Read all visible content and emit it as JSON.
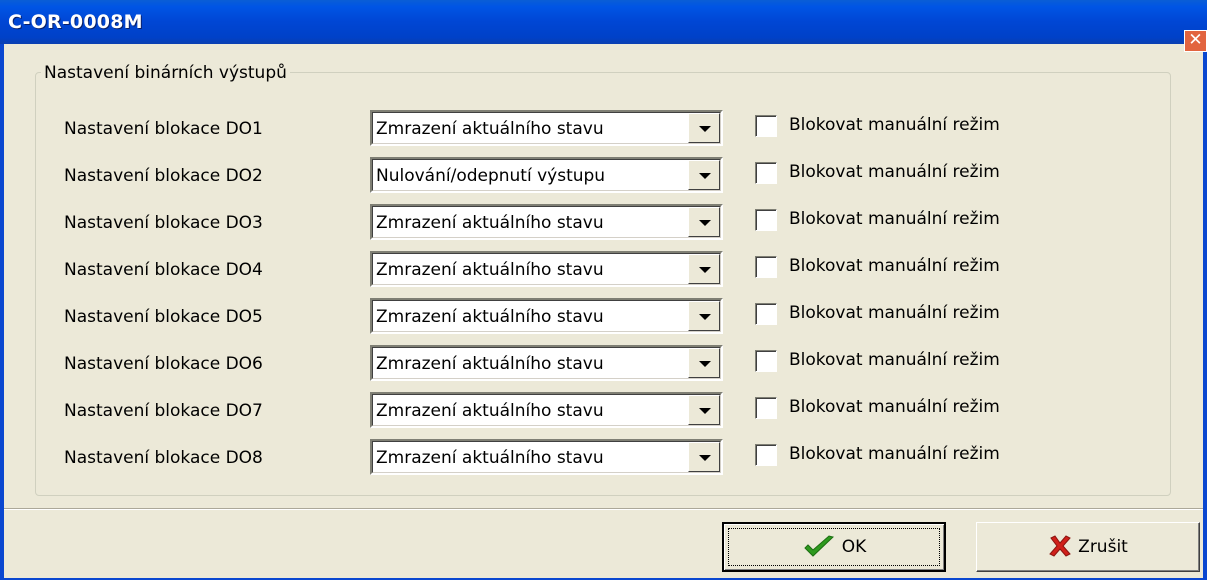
{
  "window": {
    "title": "C-OR-0008M",
    "close_icon": "close-icon"
  },
  "group": {
    "title": "Nastavení binárních výstupů"
  },
  "rows": [
    {
      "label": "Nastavení blokace DO1",
      "value": "Zmrazení aktuálního stavu",
      "checkbox_label": "Blokovat manuální režim",
      "checked": false
    },
    {
      "label": "Nastavení blokace DO2",
      "value": "Nulování/odepnutí výstupu",
      "checkbox_label": "Blokovat manuální režim",
      "checked": false
    },
    {
      "label": "Nastavení blokace DO3",
      "value": "Zmrazení aktuálního stavu",
      "checkbox_label": "Blokovat manuální režim",
      "checked": false
    },
    {
      "label": "Nastavení blokace DO4",
      "value": "Zmrazení aktuálního stavu",
      "checkbox_label": "Blokovat manuální režim",
      "checked": false
    },
    {
      "label": "Nastavení blokace DO5",
      "value": "Zmrazení aktuálního stavu",
      "checkbox_label": "Blokovat manuální režim",
      "checked": false
    },
    {
      "label": "Nastavení blokace DO6",
      "value": "Zmrazení aktuálního stavu",
      "checkbox_label": "Blokovat manuální režim",
      "checked": false
    },
    {
      "label": "Nastavení blokace DO7",
      "value": "Zmrazení aktuálního stavu",
      "checkbox_label": "Blokovat manuální režim",
      "checked": false
    },
    {
      "label": "Nastavení blokace DO8",
      "value": "Zmrazení aktuálního stavu",
      "checkbox_label": "Blokovat manuální režim",
      "checked": false
    }
  ],
  "buttons": {
    "ok_label": "OK",
    "ok_icon": "checkmark-icon",
    "cancel_label": "Zrušit",
    "cancel_icon": "red-x-icon"
  },
  "colors": {
    "titlebar": "#0055e5",
    "dialog_bg": "#ECE9D8",
    "ok_check": "#2e9a1e",
    "cancel_x": "#d0201a"
  }
}
